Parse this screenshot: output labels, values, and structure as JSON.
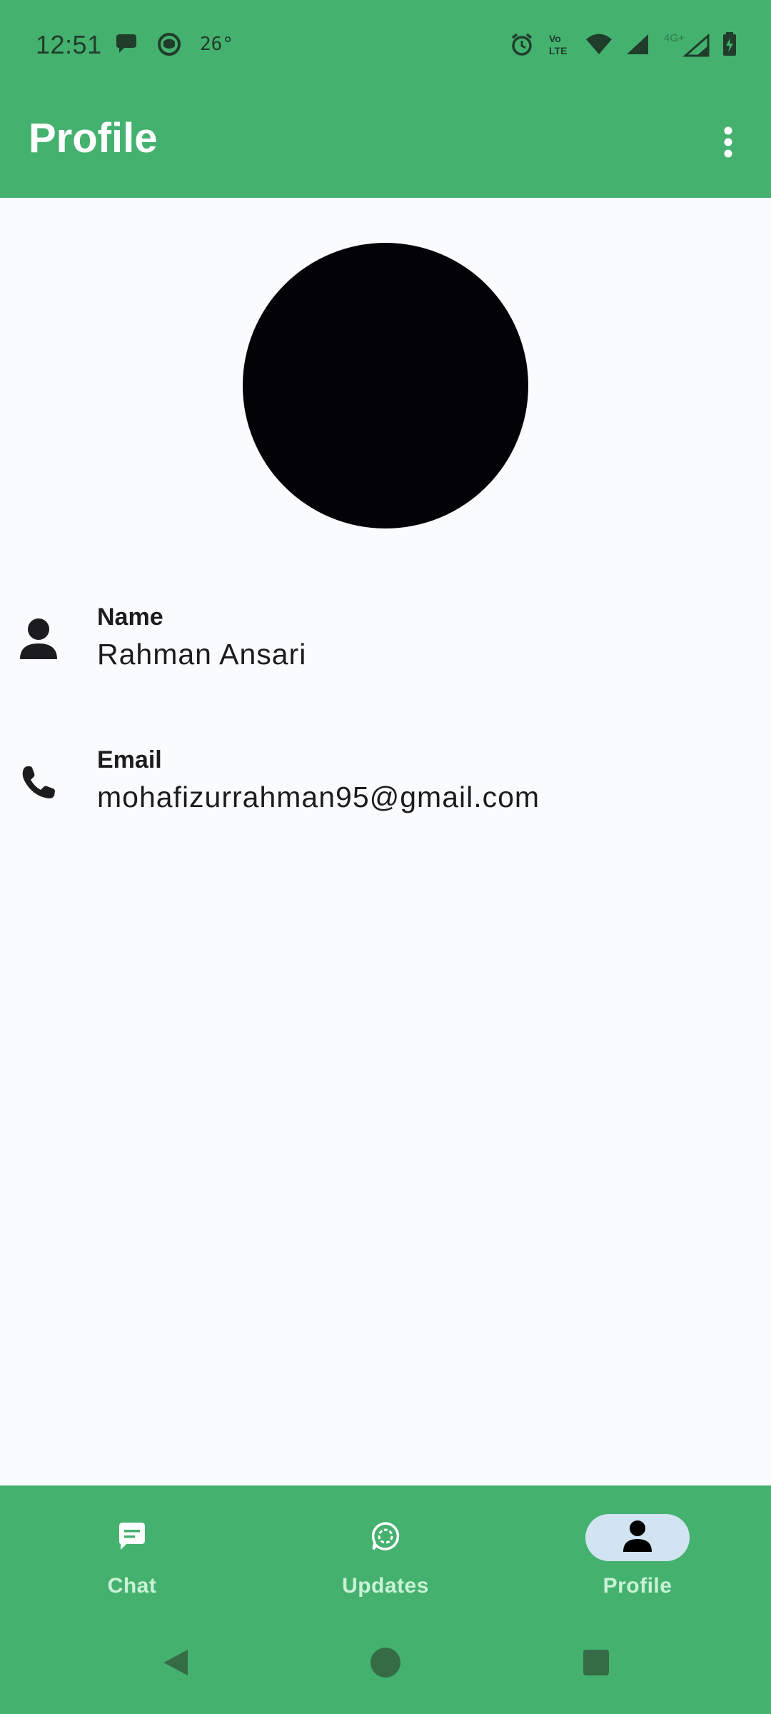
{
  "status_bar": {
    "time": "12:51",
    "temperature": "26°",
    "left_icons": [
      "chat-bubble-icon",
      "notification-app-icon"
    ],
    "right_icons": [
      "alarm-icon",
      "volte-icon",
      "wifi-icon",
      "signal-icon",
      "4g-signal-icon",
      "battery-charging-icon"
    ],
    "network_label": "4G+",
    "volte_top": "Vo",
    "volte_bottom": "LTE"
  },
  "app_bar": {
    "title": "Profile",
    "menu_icon": "more-vert-icon"
  },
  "profile": {
    "avatar_icon": "avatar",
    "name_label": "Name",
    "name_value": "Rahman Ansari",
    "email_label": "Email",
    "email_value": "mohafizurrahman95@gmail.com",
    "name_icon": "person-icon",
    "email_icon": "phone-icon"
  },
  "bottom_nav": {
    "items": [
      {
        "label": "Chat",
        "icon": "chat-icon",
        "active": false
      },
      {
        "label": "Updates",
        "icon": "updates-icon",
        "active": false
      },
      {
        "label": "Profile",
        "icon": "person-icon",
        "active": true
      }
    ]
  },
  "system_nav": {
    "buttons": [
      "back-icon",
      "home-icon",
      "recents-icon"
    ]
  },
  "colors": {
    "primary": "#45B16F",
    "background": "#F9FBFF",
    "nav_label": "#C9F2D7",
    "active_indicator": "#D2E4F1",
    "avatar": "#030305"
  }
}
